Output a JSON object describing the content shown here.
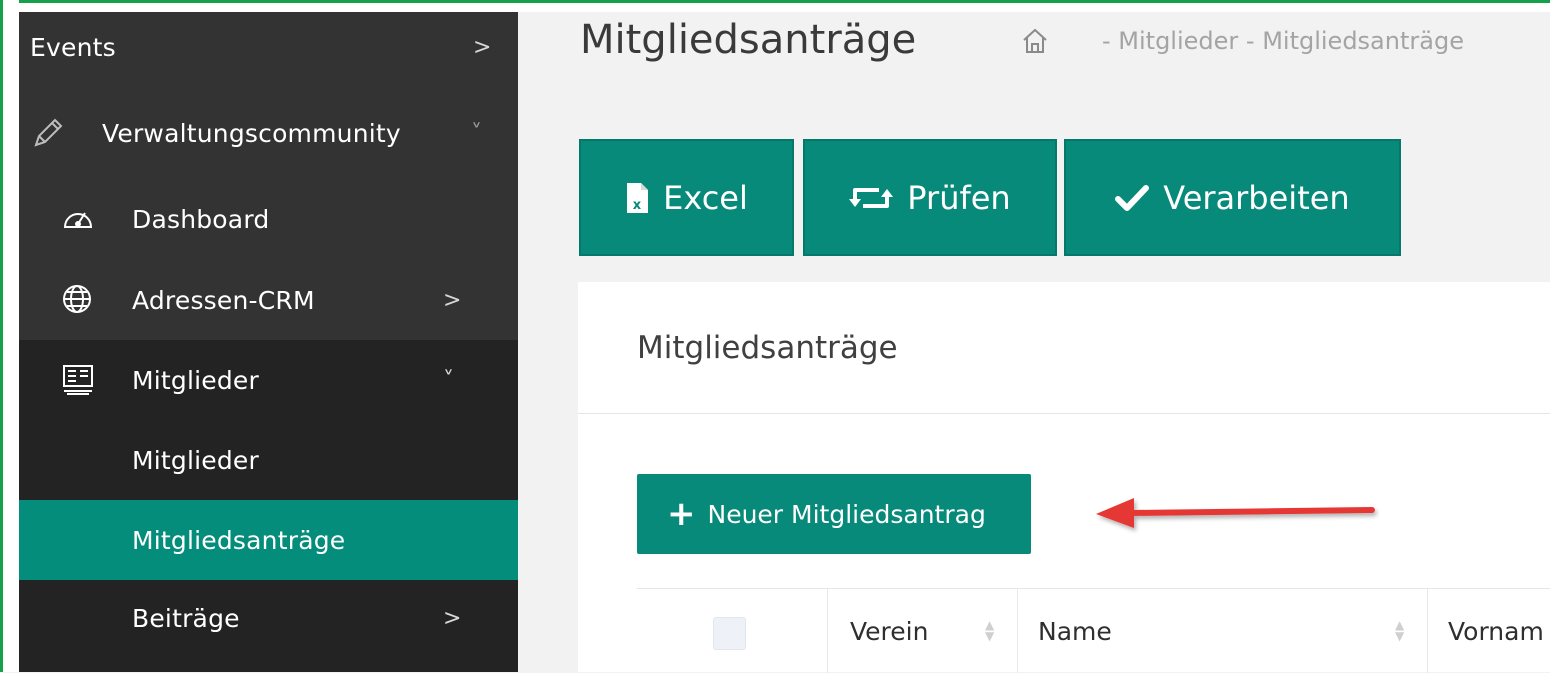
{
  "sidebar": {
    "items": [
      {
        "label": "Events",
        "chevron": ">",
        "icon": ""
      },
      {
        "label": "Verwaltungscommunity",
        "chevron": "˅",
        "icon": "pencil-icon"
      },
      {
        "label": "Dashboard",
        "chevron": "",
        "icon": "speedometer-icon"
      },
      {
        "label": "Adressen-CRM",
        "chevron": ">",
        "icon": "globe-icon"
      },
      {
        "label": "Mitglieder",
        "chevron": "˅",
        "icon": "members-icon"
      },
      {
        "label": "Mitglieder",
        "chevron": "",
        "icon": ""
      },
      {
        "label": "Mitgliedsanträge",
        "chevron": "",
        "icon": ""
      },
      {
        "label": "Beiträge",
        "chevron": ">",
        "icon": ""
      }
    ]
  },
  "header": {
    "title": "Mitgliedsanträge",
    "breadcrumb": "- Mitglieder - Mitgliedsanträge"
  },
  "toolbar": {
    "excel_label": "Excel",
    "pruefen_label": "Prüfen",
    "verarbeiten_label": "Verarbeiten"
  },
  "card": {
    "title": "Mitgliedsanträge",
    "new_button_label": "Neuer Mitgliedsantrag"
  },
  "table": {
    "columns": [
      "Verein",
      "Name",
      "Vornam"
    ]
  },
  "colors": {
    "accent": "#078a7a",
    "sidebar": "#333333",
    "sidebar_dark": "#232323",
    "arrow": "#e53935"
  }
}
